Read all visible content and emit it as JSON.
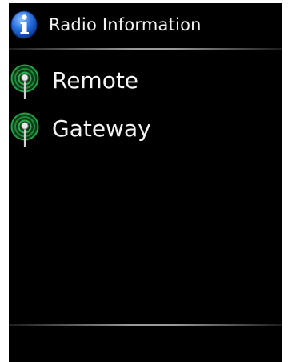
{
  "header": {
    "icon": "info-icon",
    "title": "Radio Information"
  },
  "menu": {
    "items": [
      {
        "label": "Remote",
        "icon": "radio-antenna-icon"
      },
      {
        "label": "Gateway",
        "icon": "radio-antenna-icon"
      }
    ]
  },
  "colors": {
    "background": "#000000",
    "text": "#f2f2f2",
    "icon_green": "#1f8a3a",
    "info_blue": "#1f63d6"
  }
}
